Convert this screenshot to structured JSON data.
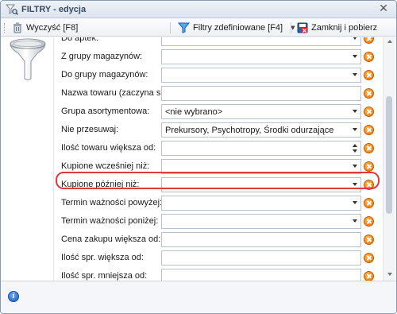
{
  "window": {
    "title": "FILTRY - edycja",
    "close_symbol": "✕",
    "icon": "funnel-search-icon"
  },
  "toolbar": {
    "clear_label": "Wyczyść [F8]",
    "clear_icon": "trash-icon",
    "defined_filters_label": "Filtry zdefiniowane [F4]",
    "defined_filters_icon": "funnel-icon",
    "defined_filters_arrow": "▼",
    "close_fetch_label": "Zamknij i pobierz",
    "close_fetch_icon": "close-save-icon"
  },
  "left_pane": {
    "icon": "funnel-large-icon"
  },
  "rows": [
    {
      "label": "Do aptek:",
      "type": "dropdown",
      "value": ""
    },
    {
      "label": "Z grupy magazynów:",
      "type": "dropdown",
      "value": ""
    },
    {
      "label": "Do grupy magazynów:",
      "type": "dropdown",
      "value": ""
    },
    {
      "label": "Nazwa towaru (zaczyna się):",
      "type": "text",
      "value": ""
    },
    {
      "label": "Grupa asortymentowa:",
      "type": "dropdown",
      "value": "<nie wybrano>"
    },
    {
      "label": "Nie przesuwaj:",
      "type": "dropdown",
      "value": "Prekursory, Psychotropy, Środki odurzające"
    },
    {
      "label": "Ilość towaru większa od:",
      "type": "spinner",
      "value": ""
    },
    {
      "label": "Kupione wcześniej niż:",
      "type": "dropdown",
      "value": ""
    },
    {
      "label": "Kupione później niż:",
      "type": "dropdown",
      "value": ""
    },
    {
      "label": "Termin ważności powyżej:",
      "type": "dropdown",
      "value": ""
    },
    {
      "label": "Termin ważności poniżej:",
      "type": "dropdown",
      "value": ""
    },
    {
      "label": "Cena zakupu większa od:",
      "type": "text",
      "value": ""
    },
    {
      "label": "Ilość spr. większa od:",
      "type": "text",
      "value": ""
    },
    {
      "label": "Ilość spr. mniejsza od:",
      "type": "text",
      "value": ""
    }
  ],
  "highlight": {
    "row_label": "Kupione później niż:",
    "color": "#e0393e"
  },
  "status": {
    "icon": "info-icon",
    "glyph": "i"
  },
  "colors": {
    "clear_icon": "#e8720c",
    "accent": "#1d5fbf"
  }
}
